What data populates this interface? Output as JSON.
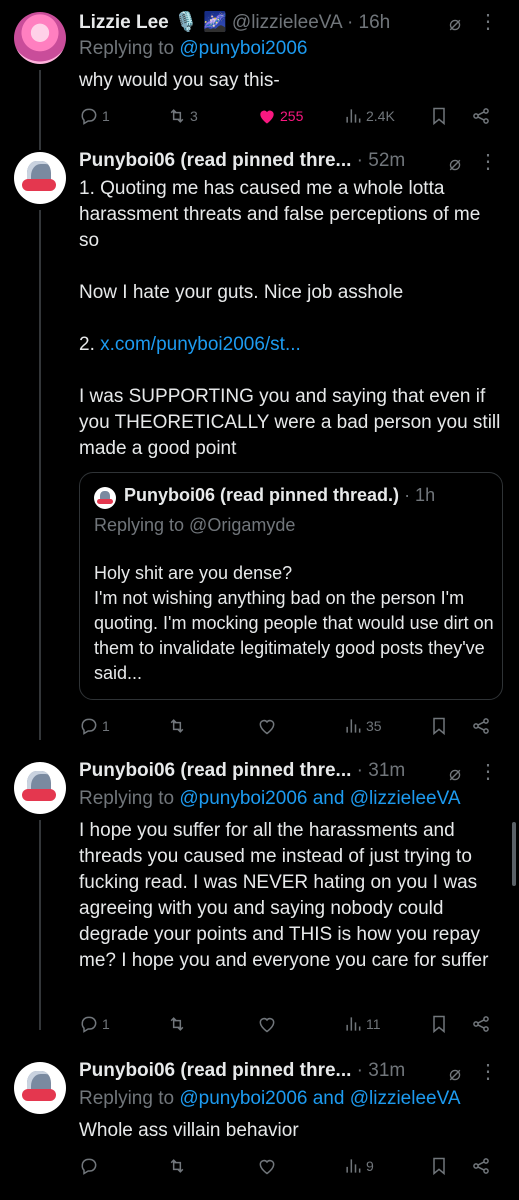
{
  "tweets": [
    {
      "name": "Lizzie Lee 🎙️ 🌌",
      "meta": "@lizzieleeVA · 16h",
      "reply_prefix": "Replying to ",
      "reply_users": "@punyboi2006",
      "reply_suffix": "",
      "text": "why would you say this-",
      "counts": {
        "replies": "1",
        "reposts": "3",
        "likes": "255",
        "views": "2.4K"
      },
      "liked": true
    },
    {
      "name": "Punyboi06 (read pinned thre...",
      "meta": "· 52m",
      "text_part1": "1. Quoting me has caused me a whole lotta harassment threats and false perceptions of me so\n\nNow I hate your guts. Nice job asshole\n\n2. ",
      "text_link": "x.com/punyboi2006/st...",
      "text_part2": "\n\nI was SUPPORTING you and saying that even if you THEORETICALLY were a bad person you still made a good point",
      "quote": {
        "name": "Punyboi06 (read pinned thread.)",
        "meta": "· 1h",
        "reply": "Replying to @Origamyde",
        "text": "Holy shit are you dense?\nI'm not wishing anything bad on the person I'm quoting. I'm mocking people that would use dirt on them to invalidate legitimately good posts they've said..."
      },
      "counts": {
        "replies": "1",
        "reposts": "",
        "likes": "",
        "views": "35"
      }
    },
    {
      "name": "Punyboi06 (read pinned thre...",
      "meta": "· 31m",
      "reply_prefix": "Replying to ",
      "reply_users": "@punyboi2006 and @lizzieleeVA",
      "text": "I hope you suffer for all the harassments and threads you caused me instead of just trying to fucking read. I was NEVER hating on you I was agreeing with you and saying nobody could degrade your points and THIS is how you repay me? I hope you and everyone you care for suffer",
      "counts": {
        "replies": "1",
        "reposts": "",
        "likes": "",
        "views": "11"
      }
    },
    {
      "name": "Punyboi06 (read pinned thre...",
      "meta": "· 31m",
      "reply_prefix": "Replying to ",
      "reply_users": "@punyboi2006 and @lizzieleeVA",
      "text": "Whole ass villain behavior",
      "counts": {
        "replies": "",
        "reposts": "",
        "likes": "",
        "views": "9"
      }
    }
  ],
  "icons": {
    "reply": "reply-icon",
    "repost": "repost-icon",
    "like": "heart-icon",
    "views": "views-icon",
    "bookmark": "bookmark-icon",
    "share": "share-icon",
    "grok": "grok-icon",
    "more": "more-icon"
  },
  "colors": {
    "link": "#1d9bf0",
    "like": "#f91880",
    "muted": "#71767b",
    "text": "#e7e9ea",
    "background": "#000000"
  }
}
